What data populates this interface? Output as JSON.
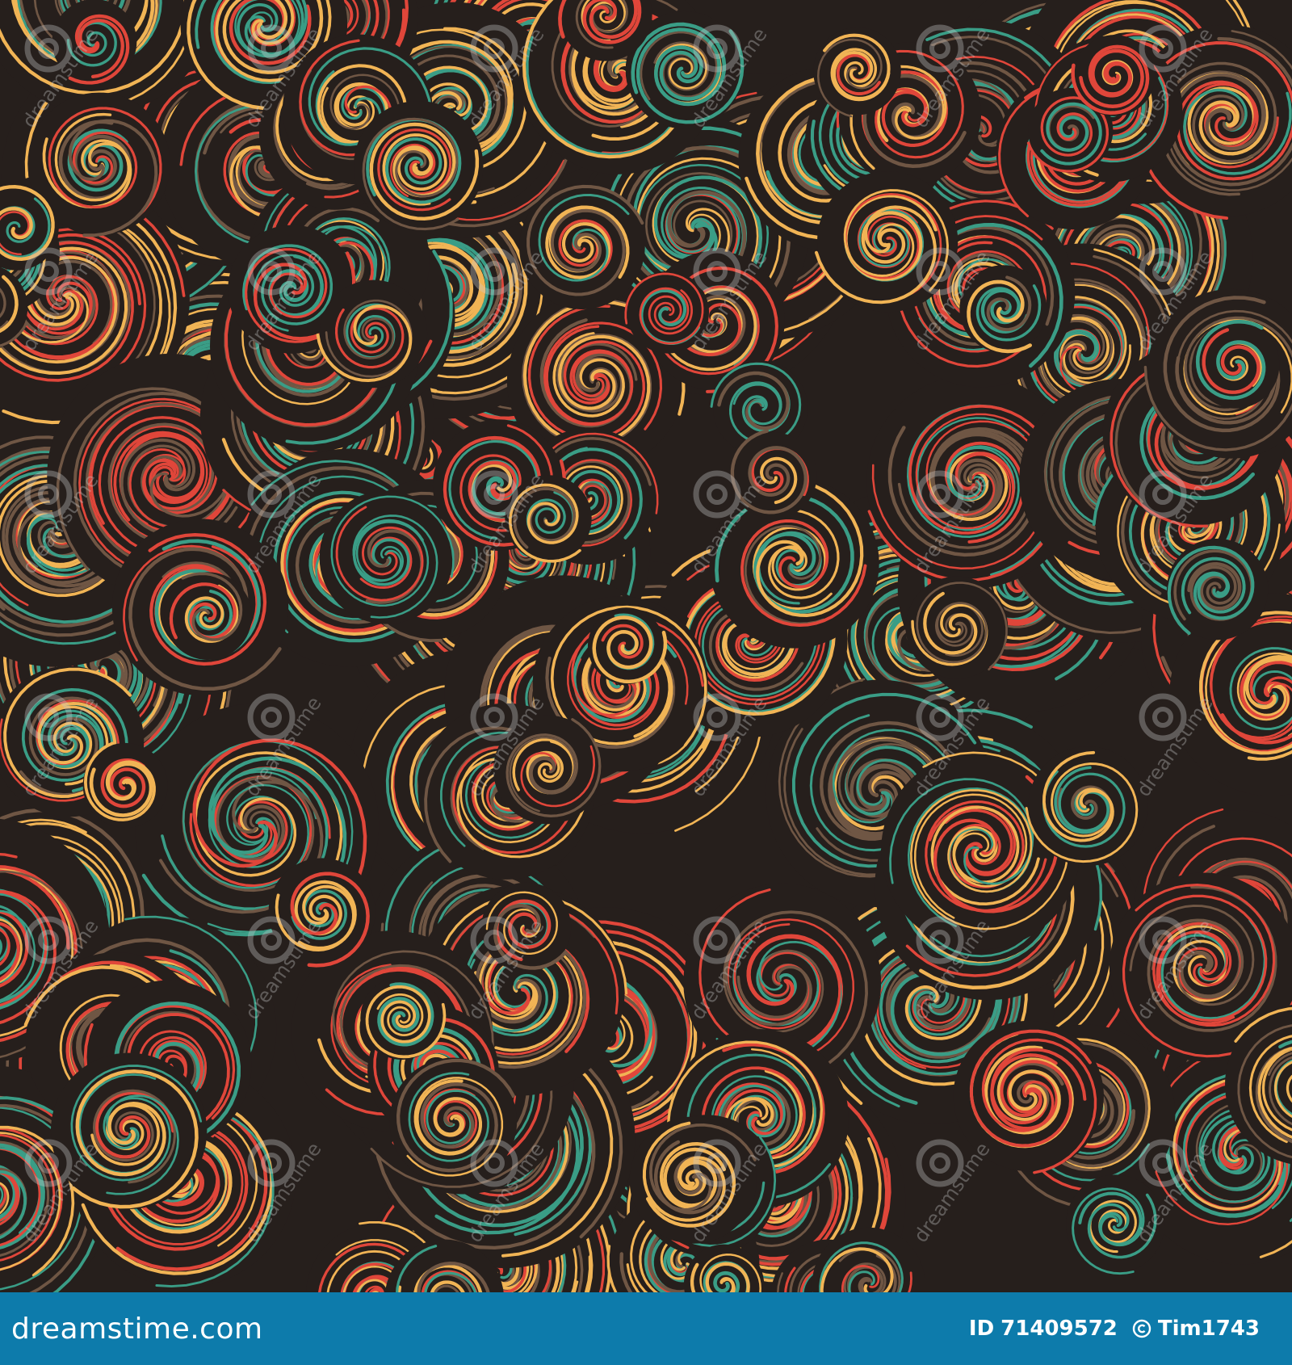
{
  "colors": {
    "background": "#261f1c",
    "teal": "#3a9d86",
    "red": "#e0463a",
    "gold": "#f1b455",
    "brown": "#6f5644",
    "watermark": "#cccccc",
    "footer_bg": "#0d7bab",
    "footer_text": "#ffffff"
  },
  "watermark": {
    "text": "dreamstime",
    "icon": "dreamstime-swirl-logo"
  },
  "footer": {
    "site": "dreamstime.com",
    "id_label": "ID",
    "id_value": "71409572",
    "author": "Tim1743",
    "author_icon": "copyright-icon"
  }
}
